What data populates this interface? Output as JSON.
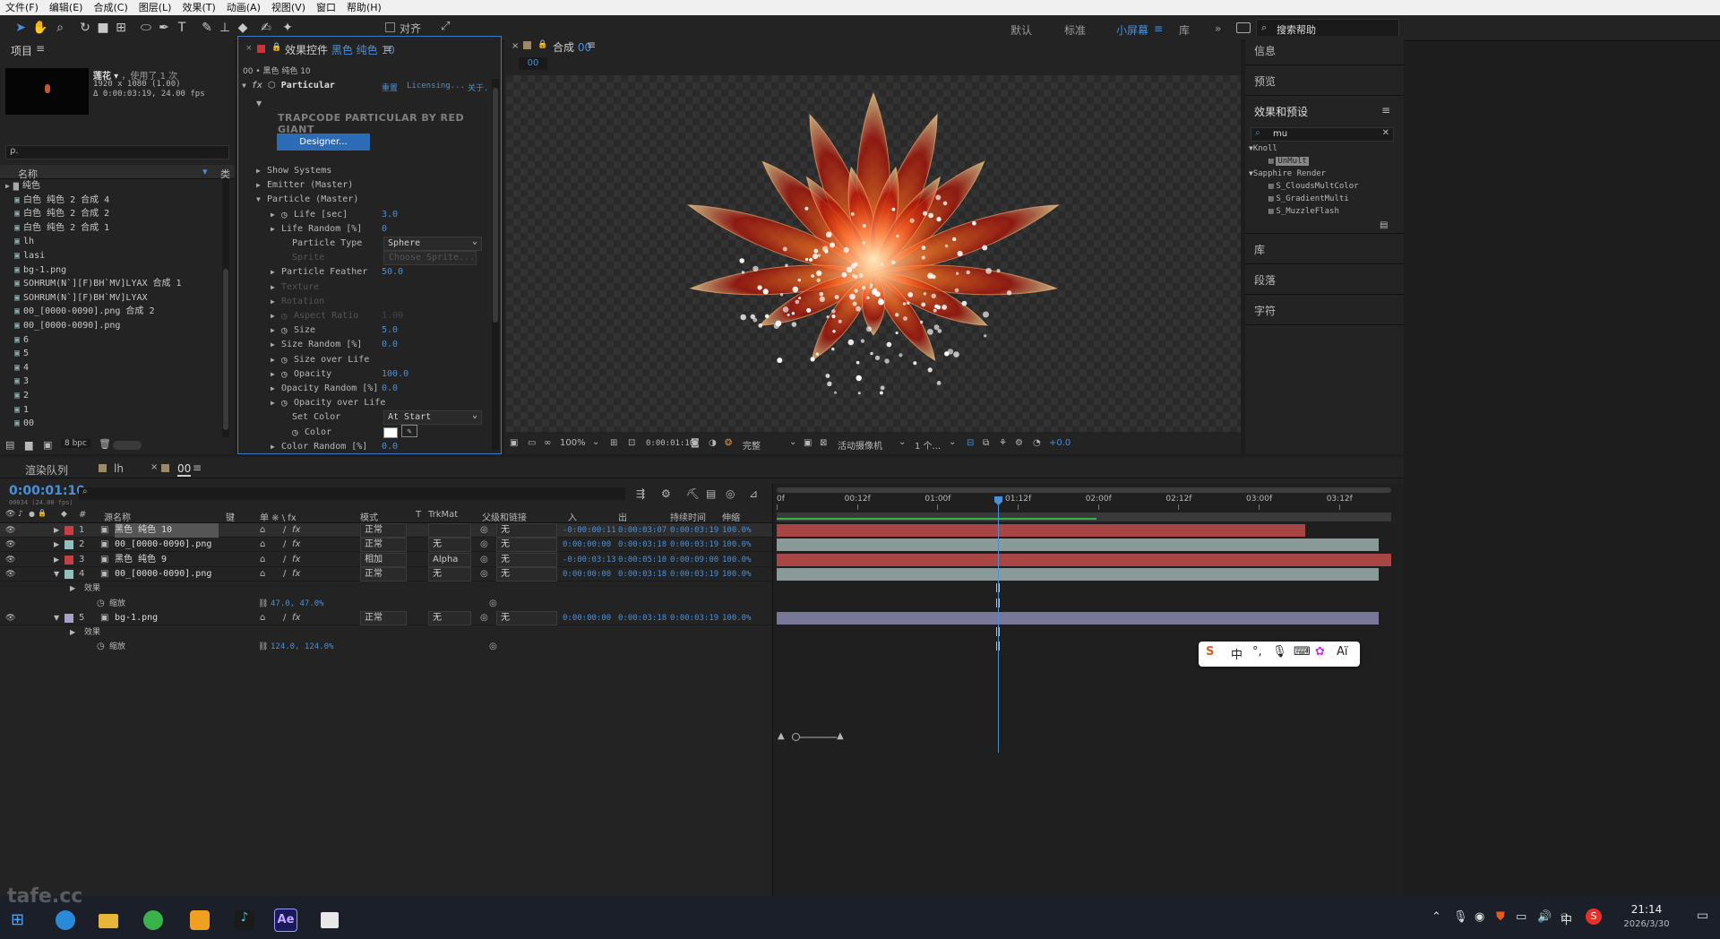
{
  "menu": [
    "文件(F)",
    "编辑(E)",
    "合成(C)",
    "图层(L)",
    "效果(T)",
    "动画(A)",
    "视图(V)",
    "窗口",
    "帮助(H)"
  ],
  "toolbar": {
    "snap_label": "对齐",
    "workspaces": [
      "默认",
      "标准",
      "小屏幕",
      "库"
    ],
    "active_workspace": "小屏幕",
    "search_help": "搜索帮助"
  },
  "project": {
    "title": "项目",
    "item_name": "莲花",
    "usage": "，使用了 1 次",
    "dims": "1920 x 1080 (1.00)",
    "duration": "Δ 0:00:03:19, 24.00 fps",
    "search_placeholder": "ρ.",
    "col_name": "名称",
    "col_type": "类",
    "bpc": "8 bpc",
    "items": [
      "纯色",
      "白色 纯色 2 合成 4",
      "白色 纯色 2 合成 2",
      "白色 纯色 2 合成 1",
      "lh",
      "lasi",
      "bg-1.png",
      "SOHRUM(N`][F)BH`MV]LYAX 合成 1",
      "SOHRUM(N`][F)BH`MV]LYAX",
      "00_[0000-0090].png 合成 2",
      "00_[0000-0090].png",
      "6",
      "5",
      "4",
      "3",
      "2",
      "1",
      "00"
    ]
  },
  "effects": {
    "panel_title": "效果控件",
    "layer_name": "黑色 纯色 10",
    "breadcrumb": "00 • 黑色 纯色 10",
    "effect_name": "Particular",
    "reset": "重置",
    "licensing": "Licensing...",
    "about": "关于.",
    "brand": "TRAPCODE PARTICULAR BY RED GIANT",
    "designer": "Designer...",
    "params": [
      {
        "label": "Show Systems",
        "indent": 1,
        "value": ""
      },
      {
        "label": "Emitter (Master)",
        "indent": 1,
        "value": ""
      },
      {
        "label": "Particle (Master)",
        "indent": 1,
        "value": "",
        "open": true
      },
      {
        "label": "Life [sec]",
        "indent": 2,
        "value": "3.0",
        "stop": true
      },
      {
        "label": "Life Random [%]",
        "indent": 2,
        "value": "0"
      },
      {
        "label": "Particle Type",
        "indent": 3,
        "value": "",
        "select": "Sphere"
      },
      {
        "label": "Sprite",
        "indent": 3,
        "value": "",
        "dim": true,
        "button": "Choose Sprite..."
      },
      {
        "label": "Particle Feather",
        "indent": 2,
        "value": "50.0"
      },
      {
        "label": "Texture",
        "indent": 2,
        "value": "",
        "dim": true
      },
      {
        "label": "Rotation",
        "indent": 2,
        "value": "",
        "dim": true
      },
      {
        "label": "Aspect Ratio",
        "indent": 2,
        "value": "1.00",
        "dim": true,
        "stop": true
      },
      {
        "label": "Size",
        "indent": 2,
        "value": "5.0",
        "stop": true
      },
      {
        "label": "Size Random [%]",
        "indent": 2,
        "value": "0.0"
      },
      {
        "label": "Size over Life",
        "indent": 2,
        "value": "",
        "stop": true
      },
      {
        "label": "Opacity",
        "indent": 2,
        "value": "100.0",
        "stop": true
      },
      {
        "label": "Opacity Random [%]",
        "indent": 2,
        "value": "0.0"
      },
      {
        "label": "Opacity over Life",
        "indent": 2,
        "value": "",
        "stop": true
      },
      {
        "label": "Set Color",
        "indent": 3,
        "value": "",
        "select": "At Start"
      },
      {
        "label": "Color",
        "indent": 3,
        "value": "",
        "stop": true,
        "color": true
      },
      {
        "label": "Color Random [%]",
        "indent": 2,
        "value": "0.0"
      }
    ]
  },
  "comp": {
    "title": "合成",
    "comp_name": "00",
    "tab": "00",
    "zoom": "100%",
    "timecode": "0:00:01:10",
    "quality": "完整",
    "camera": "活动摄像机",
    "views": "1 个...",
    "exposure": "+0.0"
  },
  "right": {
    "info": "信息",
    "preview": "预览",
    "effects_presets": "效果和预设",
    "search": "mu",
    "tree": [
      {
        "group": "Knoll",
        "items": [
          "UnMult"
        ]
      },
      {
        "group": "Sapphire Render",
        "items": [
          "S_CloudsMultColor",
          "S_GradientMulti",
          "S_MuzzleFlash"
        ]
      }
    ],
    "library": "库",
    "paragraph": "段落",
    "character": "字符"
  },
  "timeline": {
    "tabs": [
      "渲染队列",
      "lh",
      "00"
    ],
    "active_tab": "00",
    "timecode": "0:00:01:10",
    "fps": "00034 (24.00 fps)",
    "cols": [
      "源名称",
      "键",
      "单 ※ \\ fx",
      "模式",
      "T",
      "TrkMat",
      "父级和链接",
      "入",
      "出",
      "持续时间",
      "伸缩"
    ],
    "ruler": [
      "0f",
      "00:12f",
      "01:00f",
      "01:12f",
      "02:00f",
      "02:12f",
      "03:00f",
      "03:12f"
    ],
    "layers": [
      {
        "num": "1",
        "label": "#c74040",
        "name": "黑色 纯色 10",
        "mode": "正常",
        "trk": "",
        "parent": "无",
        "in": "-0:00:00:11",
        "out": "0:00:03:07",
        "dur": "0:00:03:19",
        "stretch": "100.0%",
        "bar": "#a84646",
        "barEnd": 0.86,
        "selected": true
      },
      {
        "num": "2",
        "label": "#8fbfbf",
        "name": "00_[0000-0090].png",
        "mode": "正常",
        "trk": "无",
        "parent": "无",
        "in": "0:00:00:00",
        "out": "0:00:03:18",
        "dur": "0:00:03:19",
        "stretch": "100.0%",
        "bar": "#8a9a98",
        "barEnd": 0.98
      },
      {
        "num": "3",
        "label": "#c74040",
        "name": "黑色 纯色 9",
        "mode": "相加",
        "trk": "Alpha",
        "parent": "无",
        "in": "-0:00:03:13",
        "out": "0:00:05:10",
        "dur": "0:00:09:00",
        "stretch": "100.0%",
        "bar": "#a84646",
        "barEnd": 1.0
      },
      {
        "num": "4",
        "label": "#8fbfbf",
        "name": "00_[0000-0090].png",
        "mode": "正常",
        "trk": "无",
        "parent": "无",
        "in": "0:00:00:00",
        "out": "0:00:03:18",
        "dur": "0:00:03:19",
        "stretch": "100.0%",
        "bar": "#8a9a98",
        "barEnd": 0.98,
        "open": true,
        "sub": [
          "效果",
          "缩放"
        ],
        "scale": "47.0, 47.0%"
      },
      {
        "num": "5",
        "label": "#a8a0c8",
        "name": "bg-1.png",
        "mode": "正常",
        "trk": "无",
        "parent": "无",
        "in": "0:00:00:00",
        "out": "0:00:03:18",
        "dur": "0:00:03:19",
        "stretch": "100.0%",
        "bar": "#7a7898",
        "barEnd": 0.98,
        "open": true,
        "sub": [
          "效果",
          "缩放"
        ],
        "scale": "124.0, 124.0%"
      }
    ],
    "playhead": 0.36
  },
  "ime": {
    "label": "中"
  },
  "taskbar": {
    "time": "21:14",
    "date": "2026/3/30",
    "ime": "中",
    "watermark": "tafe.cc"
  }
}
